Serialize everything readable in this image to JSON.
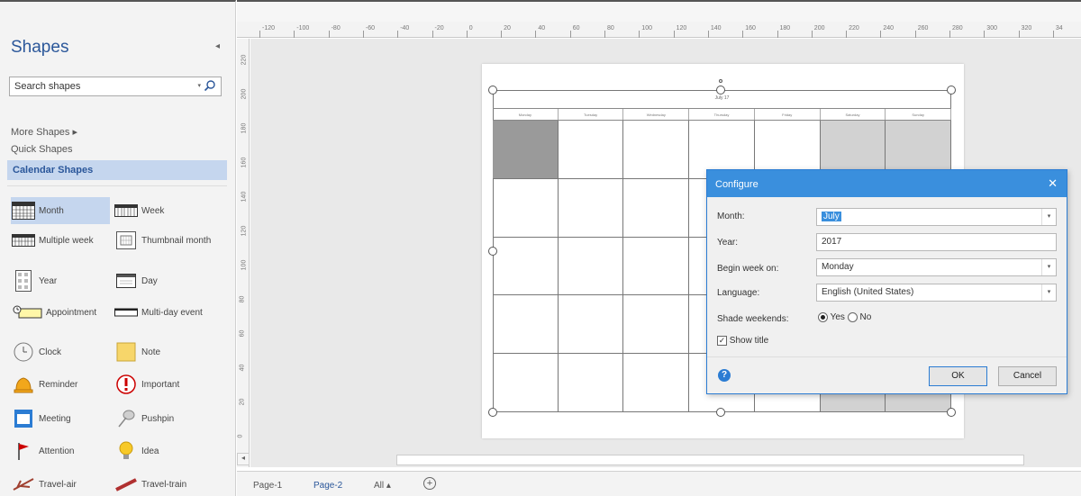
{
  "shapes_pane": {
    "title": "Shapes",
    "search_value": "Search shapes",
    "nav": {
      "more_shapes": "More Shapes",
      "more_arrow": "▸",
      "quick_shapes": "Quick Shapes",
      "calendar_shapes": "Calendar Shapes"
    },
    "shapes": [
      {
        "label": "Month",
        "icon": "month-icon"
      },
      {
        "label": "Week",
        "icon": "week-icon"
      },
      {
        "label": "Multiple week",
        "icon": "multiple-week-icon"
      },
      {
        "label": "Thumbnail month",
        "icon": "thumbnail-month-icon"
      },
      {
        "label": "Year",
        "icon": "year-icon"
      },
      {
        "label": "Day",
        "icon": "day-icon"
      },
      {
        "label": "Appointment",
        "icon": "appointment-icon"
      },
      {
        "label": "Multi-day event",
        "icon": "multi-day-event-icon"
      },
      {
        "label": "Clock",
        "icon": "clock-icon"
      },
      {
        "label": "Note",
        "icon": "note-icon"
      },
      {
        "label": "Reminder",
        "icon": "reminder-icon"
      },
      {
        "label": "Important",
        "icon": "important-icon"
      },
      {
        "label": "Meeting",
        "icon": "meeting-icon"
      },
      {
        "label": "Pushpin",
        "icon": "pushpin-icon"
      },
      {
        "label": "Attention",
        "icon": "attention-icon"
      },
      {
        "label": "Idea",
        "icon": "idea-icon"
      },
      {
        "label": "Travel-air",
        "icon": "travel-air-icon"
      },
      {
        "label": "Travel-train",
        "icon": "travel-train-icon"
      }
    ]
  },
  "ruler": {
    "top_ticks": [
      "-120",
      "-100",
      "-80",
      "-60",
      "-40",
      "-20",
      "0",
      "20",
      "40",
      "60",
      "80",
      "100",
      "120",
      "140",
      "160",
      "180",
      "200",
      "220",
      "240",
      "260",
      "280",
      "300",
      "320",
      "34"
    ],
    "left_ticks": [
      "220",
      "200",
      "180",
      "160",
      "140",
      "120",
      "100",
      "80",
      "60",
      "40",
      "20",
      "0"
    ]
  },
  "calendar": {
    "title": "July 17",
    "weekdays": [
      "Monday",
      "Tuesday",
      "Wednesday",
      "Thursday",
      "Friday",
      "Saturday",
      "Sunday"
    ]
  },
  "dialog": {
    "title": "Configure",
    "month_label": "Month:",
    "month_value": "July",
    "year_label": "Year:",
    "year_value": "2017",
    "begin_week_label": "Begin week on:",
    "begin_week_value": "Monday",
    "language_label": "Language:",
    "language_value": "English (United States)",
    "shade_weekends_label": "Shade weekends:",
    "shade_yes": "Yes",
    "shade_no": "No",
    "show_title_label": "Show title",
    "ok": "OK",
    "cancel": "Cancel"
  },
  "pages": {
    "page1": "Page-1",
    "page2": "Page-2",
    "all": "All ▴"
  },
  "colors": {
    "accent": "#2b579a",
    "dialog_title": "#3a8fdd"
  }
}
